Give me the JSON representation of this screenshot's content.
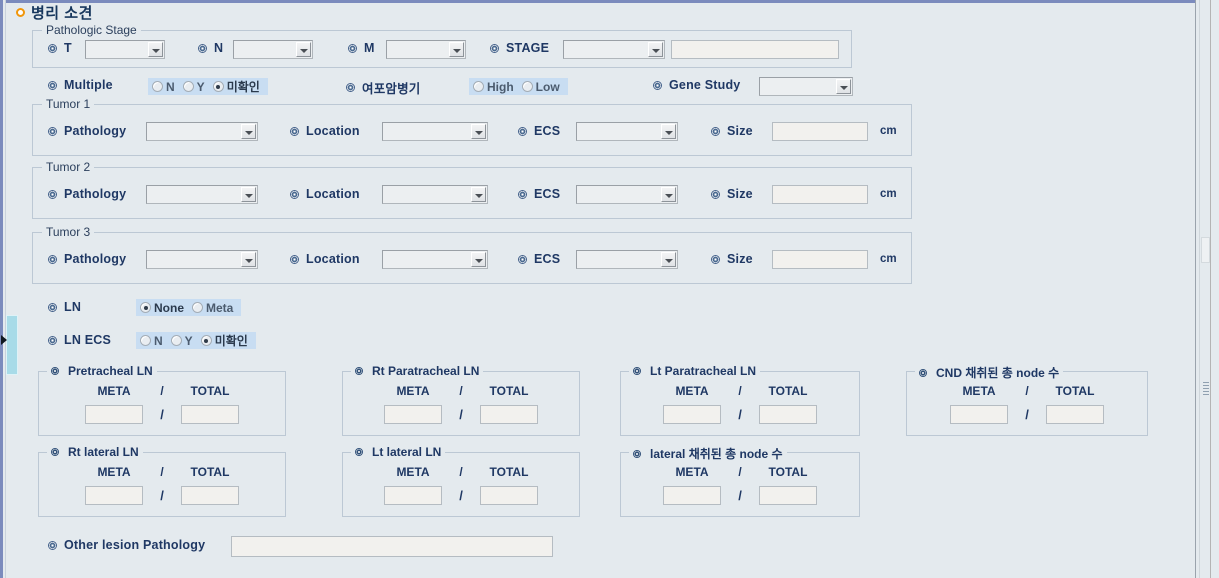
{
  "page": {
    "title": "병리 소견",
    "title_icon": "orange-ring-icon"
  },
  "colors": {
    "background": "#e4eaee",
    "label": "#1f3864",
    "accent_orange": "#f0960a",
    "radio_group_bg": "#c8ddf2",
    "border": "#bcc8d4",
    "frame_blue": "#7b8bbd",
    "handle_cyan": "#a8dbe8"
  },
  "pathologic_stage": {
    "legend": "Pathologic Stage",
    "fields": [
      {
        "label": "T",
        "value": "",
        "type": "dropdown"
      },
      {
        "label": "N",
        "value": "",
        "type": "dropdown"
      },
      {
        "label": "M",
        "value": "",
        "type": "dropdown"
      },
      {
        "label": "STAGE",
        "value": "",
        "type": "dropdown"
      }
    ],
    "stage_text": {
      "value": "",
      "placeholder": ""
    }
  },
  "multiple": {
    "label": "Multiple",
    "options": [
      {
        "label": "N",
        "selected": false
      },
      {
        "label": "Y",
        "selected": false
      },
      {
        "label": "미확인",
        "selected": true
      }
    ]
  },
  "follicular_stage": {
    "label": "여포암병기",
    "options": [
      {
        "label": "High",
        "selected": false
      },
      {
        "label": "Low",
        "selected": false
      }
    ]
  },
  "gene_study": {
    "label": "Gene Study",
    "value": ""
  },
  "tumors": [
    {
      "legend": "Tumor 1",
      "pathology": {
        "label": "Pathology",
        "value": ""
      },
      "location": {
        "label": "Location",
        "value": ""
      },
      "ecs": {
        "label": "ECS",
        "value": ""
      },
      "size": {
        "label": "Size",
        "value": "",
        "unit": "cm"
      }
    },
    {
      "legend": "Tumor 2",
      "pathology": {
        "label": "Pathology",
        "value": ""
      },
      "location": {
        "label": "Location",
        "value": ""
      },
      "ecs": {
        "label": "ECS",
        "value": ""
      },
      "size": {
        "label": "Size",
        "value": "",
        "unit": "cm"
      }
    },
    {
      "legend": "Tumor 3",
      "pathology": {
        "label": "Pathology",
        "value": ""
      },
      "location": {
        "label": "Location",
        "value": ""
      },
      "ecs": {
        "label": "ECS",
        "value": ""
      },
      "size": {
        "label": "Size",
        "value": "",
        "unit": "cm"
      }
    }
  ],
  "ln": {
    "label": "LN",
    "options": [
      {
        "label": "None",
        "selected": true
      },
      {
        "label": "Meta",
        "selected": false
      }
    ]
  },
  "ln_ecs": {
    "label": "LN ECS",
    "options": [
      {
        "label": "N",
        "selected": false
      },
      {
        "label": "Y",
        "selected": false
      },
      {
        "label": "미확인",
        "selected": true
      }
    ]
  },
  "ln_counts": {
    "meta_header": "META",
    "total_header": "TOTAL",
    "separator": "/",
    "boxes": [
      {
        "legend": "Pretracheal LN",
        "meta": "",
        "total": ""
      },
      {
        "legend": "Rt Paratracheal LN",
        "meta": "",
        "total": ""
      },
      {
        "legend": "Lt Paratracheal LN",
        "meta": "",
        "total": ""
      },
      {
        "legend": "CND 채취된 총 node 수",
        "meta": "",
        "total": ""
      },
      {
        "legend": "Rt lateral LN",
        "meta": "",
        "total": ""
      },
      {
        "legend": "Lt lateral LN",
        "meta": "",
        "total": ""
      },
      {
        "legend": "lateral 채취된 총 node 수",
        "meta": "",
        "total": ""
      }
    ]
  },
  "other_lesion": {
    "label": "Other lesion Pathology",
    "value": ""
  }
}
